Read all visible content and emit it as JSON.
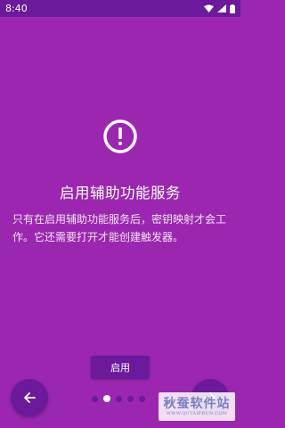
{
  "status_bar": {
    "time": "8:40",
    "icons": [
      "wifi-icon",
      "signal-icon",
      "battery-icon"
    ]
  },
  "onboarding": {
    "icon": "alert-circle-icon",
    "title": "启用辅助功能服务",
    "description": "只有在启用辅助功能服务后，密钥映射才会工作。它还需要打开才能创建触发器。",
    "enable_label": "启用",
    "page_count": 5,
    "current_page": 2
  },
  "navigation": {
    "prev_icon": "arrow-left-icon",
    "next_icon": "arrow-right-icon"
  },
  "watermark": {
    "main": "秋蚕软件站",
    "sub": "WWW.QUTAIFRUN.COM"
  },
  "colors": {
    "background": "#9b27b0",
    "status_bar": "#6a1a9a",
    "button": "#6a1a9a",
    "text": "#ffffff"
  }
}
